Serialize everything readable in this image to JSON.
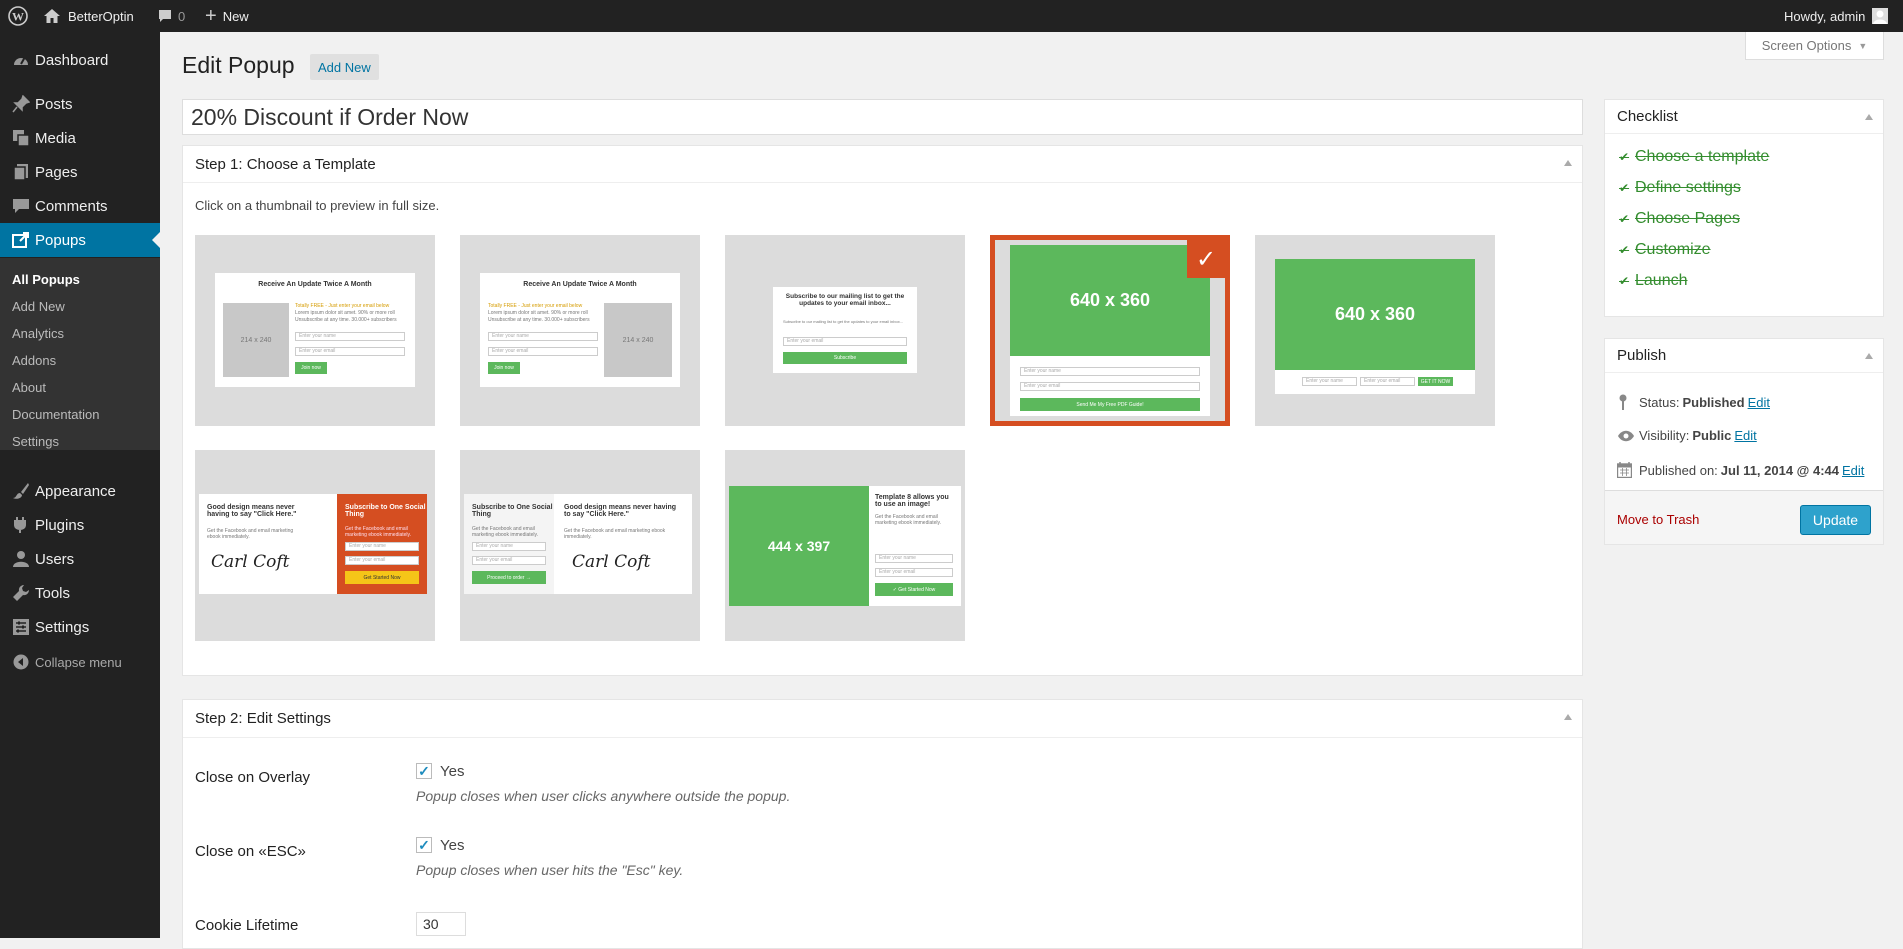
{
  "adminbar": {
    "site_name": "BetterOptin",
    "comments_count": "0",
    "new_label": "New",
    "howdy": "Howdy, admin"
  },
  "sidebar": {
    "items": [
      {
        "label": "Dashboard",
        "icon": "dashboard-icon"
      },
      {
        "label": "Posts",
        "icon": "pin-icon"
      },
      {
        "label": "Media",
        "icon": "media-icon"
      },
      {
        "label": "Pages",
        "icon": "pages-icon"
      },
      {
        "label": "Comments",
        "icon": "comment-icon"
      },
      {
        "label": "Popups",
        "icon": "popup-icon"
      },
      {
        "label": "Appearance",
        "icon": "brush-icon"
      },
      {
        "label": "Plugins",
        "icon": "plug-icon"
      },
      {
        "label": "Users",
        "icon": "user-icon"
      },
      {
        "label": "Tools",
        "icon": "wrench-icon"
      },
      {
        "label": "Settings",
        "icon": "settings-icon"
      },
      {
        "label": "Collapse menu",
        "icon": "collapse-icon"
      }
    ],
    "submenu": [
      "All Popups",
      "Add New",
      "Analytics",
      "Addons",
      "About",
      "Documentation",
      "Settings"
    ]
  },
  "header": {
    "title": "Edit Popup",
    "add_new": "Add New",
    "screen_options": "Screen Options"
  },
  "post_title": "20% Discount if Order Now",
  "step1": {
    "title": "Step 1: Choose a Template",
    "hint": "Click on a thumbnail to preview in full size.",
    "templates": {
      "t1": {
        "heading": "Receive An Update Twice A Month",
        "placeholder": "214 x 240",
        "button": "Join now",
        "text_a": "Totally FREE - Just enter your email below",
        "text_b": "Lorem ipsum dolor sit amet. 90% or more roll",
        "text_c": "Unsubscribe at any time. 30.000+ subscribers",
        "field1": "Enter your name",
        "field2": "Enter your email"
      },
      "t2": {
        "heading": "Receive An Update Twice A Month",
        "placeholder": "214 x 240",
        "button": "Join now"
      },
      "t3": {
        "heading": "Subscribe to our mailing list to get the updates to your email inbox...",
        "text": "Subscribe to our mailing list to get the updates to your email inbox...",
        "field": "Enter your email",
        "button": "Subscribe"
      },
      "t4": {
        "image": "640 x 360",
        "field1": "Enter your name",
        "field2": "Enter your email",
        "button": "Send Me My Free PDF Guide!",
        "check": "✓"
      },
      "t5": {
        "image": "640 x 360",
        "field1": "Enter your name",
        "field2": "Enter your email",
        "button": "GET IT NOW"
      },
      "t6": {
        "heading": "Good design means never having to say \"Click Here.\"",
        "side_title": "Subscribe to One Social Thing",
        "side_text": "Get the Facebook and email marketing ebook immediately.",
        "button": "Get Started Now",
        "signature": "Carl Coft"
      },
      "t7": {
        "side_title": "Subscribe to One Social Thing",
        "heading": "Good design means never having to say \"Click Here.\"",
        "button": "Proceed to order →",
        "signature": "Carl Coft"
      },
      "t8": {
        "image": "444 x 397",
        "heading": "Template 8 allows you to use an image!",
        "button": "✓ Get Started Now"
      }
    }
  },
  "step2": {
    "title": "Step 2: Edit Settings",
    "close_overlay_label": "Close on Overlay",
    "close_overlay_value": "Yes",
    "close_overlay_desc": "Popup closes when user clicks anywhere outside the popup.",
    "close_esc_label": "Close on «ESC»",
    "close_esc_value": "Yes",
    "close_esc_desc": "Popup closes when user hits the \"Esc\" key.",
    "cookie_label": "Cookie Lifetime",
    "cookie_value": "30"
  },
  "checklist": {
    "title": "Checklist",
    "items": [
      "Choose a template",
      "Define settings",
      "Choose Pages",
      "Customize",
      "Launch"
    ]
  },
  "publish": {
    "title": "Publish",
    "status_label": "Status:",
    "status_value": "Published",
    "visibility_label": "Visibility:",
    "visibility_value": "Public",
    "published_label": "Published on:",
    "published_value": "Jul 11, 2014 @ 4:44",
    "edit": "Edit",
    "trash": "Move to Trash",
    "update": "Update"
  },
  "colors": {
    "accent": "#0074a2",
    "selected_template": "#d54e21",
    "green": "#5cb85c",
    "checklist_done": "#348d2f"
  }
}
